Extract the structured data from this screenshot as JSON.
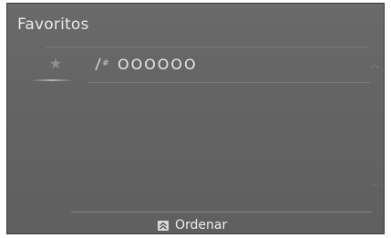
{
  "header": {
    "title": "Favoritos"
  },
  "favorites": {
    "items": [
      {
        "label": "OOOOOO",
        "icon": "phone-contact-icon",
        "indicator_icon": "star-icon"
      }
    ]
  },
  "footer": {
    "sort_label": "Ordenar",
    "sort_icon": "double-chevron-up-icon"
  },
  "colors": {
    "background": "#646464",
    "text": "#e9e9e9"
  }
}
